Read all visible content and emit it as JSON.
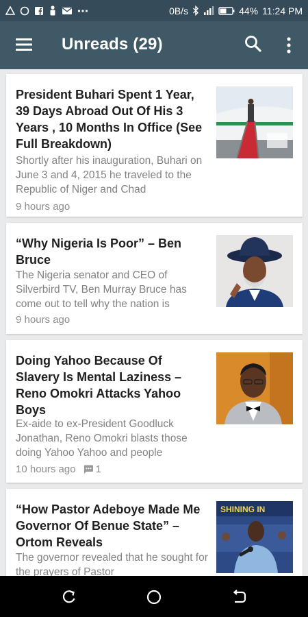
{
  "status_bar": {
    "network_speed": "0B/s",
    "battery": "44%",
    "time": "11:24 PM"
  },
  "app_bar": {
    "title": "Unreads (29)",
    "icons": [
      "menu-icon",
      "search-icon",
      "more-vert-icon"
    ]
  },
  "articles": [
    {
      "title": "President Buhari Spent 1 Year, 39 Days Abroad Out Of His 3 Years , 10 Months In Office (See Full Breakdown)",
      "excerpt": "Shortly after his inauguration, Buhari on June 3 and 4, 2015 he traveled to the Republic of Niger and Chad",
      "time": "9 hours ago",
      "comments": ""
    },
    {
      "title": "“Why Nigeria Is Poor” – Ben Bruce",
      "excerpt": "The Nigeria senator and CEO of Silverbird TV, Ben Murray Bruce has come out to tell why the nation is",
      "time": "9 hours ago",
      "comments": ""
    },
    {
      "title": "Doing Yahoo Because Of Slavery Is Mental Laziness – Reno Omokri Attacks Yahoo Boys",
      "excerpt": "Ex-aide to ex-President Goodluck Jonathan, Reno Omokri blasts those doing Yahoo Yahoo and people",
      "time": "10 hours ago",
      "comments": "1"
    },
    {
      "title": "“How Pastor Adeboye Made Me Governor Of Benue State” – Ortom Reveals",
      "excerpt": "The governor revealed that he sought for the prayers of Pastor",
      "time": "",
      "comments": ""
    }
  ],
  "thumb_text": {
    "banner": "SHINING IN"
  },
  "colors": {
    "status_bar": "#354b59",
    "app_bar": "#3f5966",
    "background": "#e9eaec",
    "title_text": "#1f1f1f",
    "excerpt_text": "#828282"
  }
}
